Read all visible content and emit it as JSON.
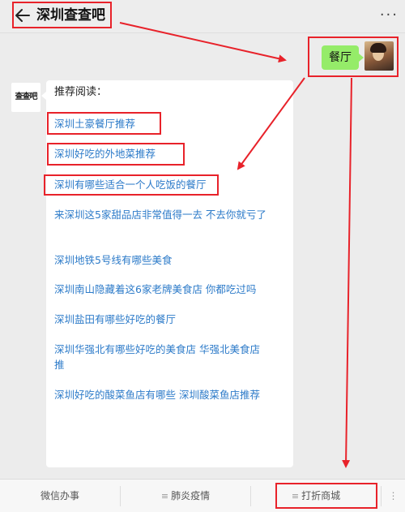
{
  "header": {
    "title": "深圳查查吧",
    "more": "···"
  },
  "chat": {
    "user_message": "餐厅",
    "bot_avatar_text": "查查吧",
    "card": {
      "heading": "推荐阅读：",
      "links": [
        "深圳土豪餐厅推荐",
        "深圳好吃的外地菜推荐",
        "深圳有哪些适合一个人吃饭的餐厅",
        "来深圳这5家甜品店非常值得一去 不去你就亏了",
        "深圳地铁5号线有哪些美食",
        "深圳南山隐藏着这6家老牌美食店 你都吃过吗",
        "深圳盐田有哪些好吃的餐厅",
        "深圳华强北有哪些好吃的美食店 华强北美食店推",
        "深圳好吃的酸菜鱼店有哪些 深圳酸菜鱼店推荐"
      ]
    }
  },
  "bottom_menu": {
    "items": [
      "微信办事",
      "肺炎疫情",
      "打折商城"
    ]
  },
  "colors": {
    "annotation": "#e8222a",
    "link": "#2d7bc9",
    "bubble": "#95ec69"
  }
}
